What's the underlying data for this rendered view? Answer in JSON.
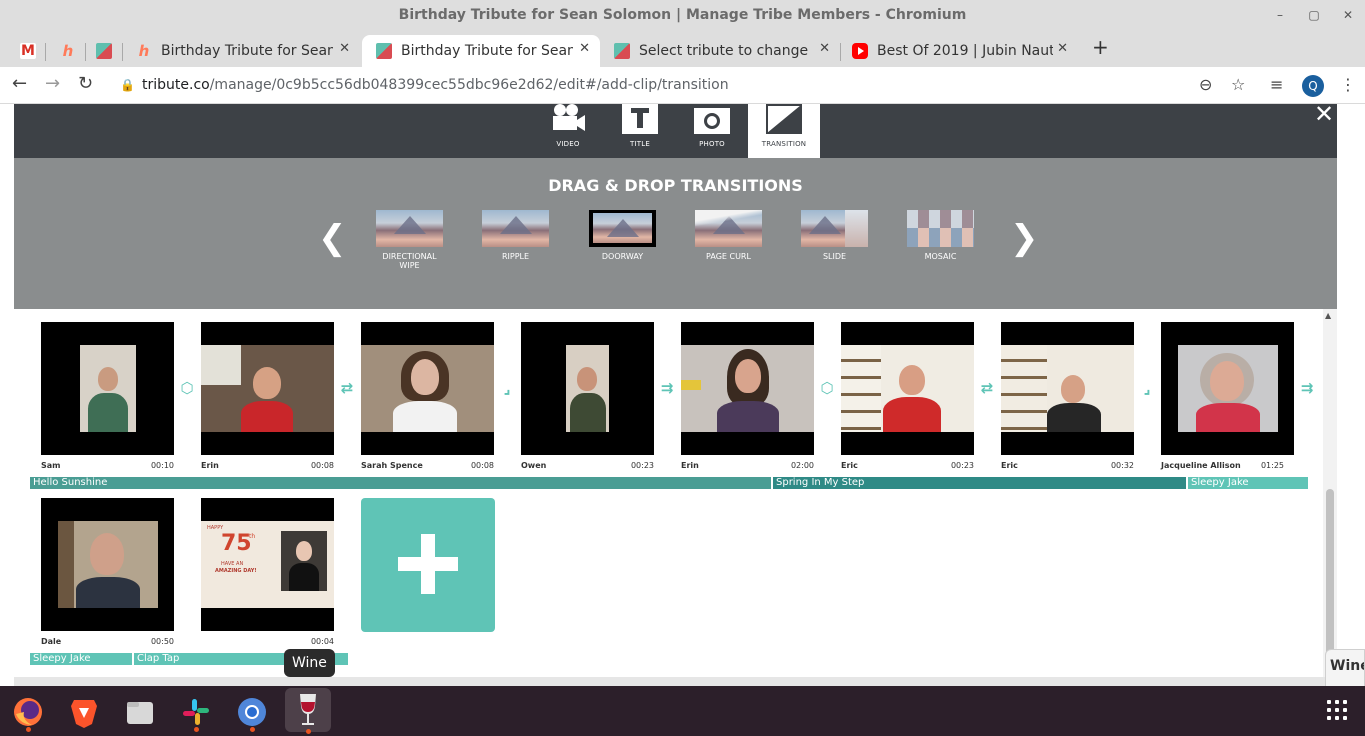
{
  "window": {
    "title": "Birthday Tribute for Sean Solomon | Manage Tribe Members - Chromium",
    "controls": [
      "–",
      "▢",
      "✕"
    ]
  },
  "tabs": [
    {
      "icon": "gmail-icon",
      "title": ""
    },
    {
      "icon": "hubspot-icon",
      "title": ""
    },
    {
      "icon": "tribute-icon",
      "title": ""
    },
    {
      "icon": "hubspot-icon",
      "title": "Birthday Tribute for Sean"
    },
    {
      "icon": "tribute-icon",
      "title": "Birthday Tribute for Sean",
      "active": true
    },
    {
      "icon": "tribute-icon",
      "title": "Select tribute to change |"
    },
    {
      "icon": "youtube-icon",
      "title": "Best Of 2019 | Jubin Naut"
    }
  ],
  "toolbar": {
    "url_host": "tribute.co",
    "url_path": "/manage/0c9b5cc56db048399cec55dbc96e2d62/edit#/add-clip/transition",
    "profile_initial": "Q"
  },
  "editor": {
    "modes": [
      {
        "label": "VIDEO",
        "icon": "video-camera-icon"
      },
      {
        "label": "TITLE",
        "icon": "title-t-icon"
      },
      {
        "label": "PHOTO",
        "icon": "camera-icon"
      },
      {
        "label": "TRANSITION",
        "icon": "transition-icon",
        "active": true
      }
    ],
    "close": "✕",
    "panel_title": "DRAG & DROP TRANSITIONS",
    "transitions": [
      {
        "label": "DIRECTIONAL WIPE"
      },
      {
        "label": "RIPPLE"
      },
      {
        "label": "DOORWAY"
      },
      {
        "label": "PAGE CURL"
      },
      {
        "label": "SLIDE"
      },
      {
        "label": "MOSAIC"
      }
    ]
  },
  "clips": [
    {
      "name": "Sam",
      "duration": "00:10"
    },
    {
      "name": "Erin",
      "duration": "00:08"
    },
    {
      "name": "Sarah Spence",
      "duration": "00:08"
    },
    {
      "name": "Owen",
      "duration": "00:23"
    },
    {
      "name": "Erin",
      "duration": "02:00"
    },
    {
      "name": "Eric",
      "duration": "00:23"
    },
    {
      "name": "Eric",
      "duration": "00:32"
    },
    {
      "name": "Jacqueline Allison",
      "duration": "01:25"
    },
    {
      "name": "Dale",
      "duration": "00:50"
    },
    {
      "name": "",
      "duration": "00:04"
    }
  ],
  "music": [
    {
      "title": "Hello Sunshine"
    },
    {
      "title": "Spring In My Step"
    },
    {
      "title": "Sleepy Jake"
    },
    {
      "title": "Sleepy Jake"
    },
    {
      "title": "Clap Tap"
    }
  ],
  "card": {
    "happy": "HAPPY",
    "number": "75",
    "sup": "th",
    "line1": "HAVE AN",
    "line2": "AMAZING DAY!"
  },
  "tooltip": "Wine",
  "wine_popup": "Wine",
  "taskbar": [
    "firefox-icon",
    "brave-icon",
    "files-icon",
    "slack-icon",
    "chromium-icon",
    "wine-icon"
  ],
  "colors": {
    "accent": "#5fc4b6",
    "header": "#3d4146",
    "panel": "#8a8d8e",
    "music_dark": "#4a9d94"
  }
}
